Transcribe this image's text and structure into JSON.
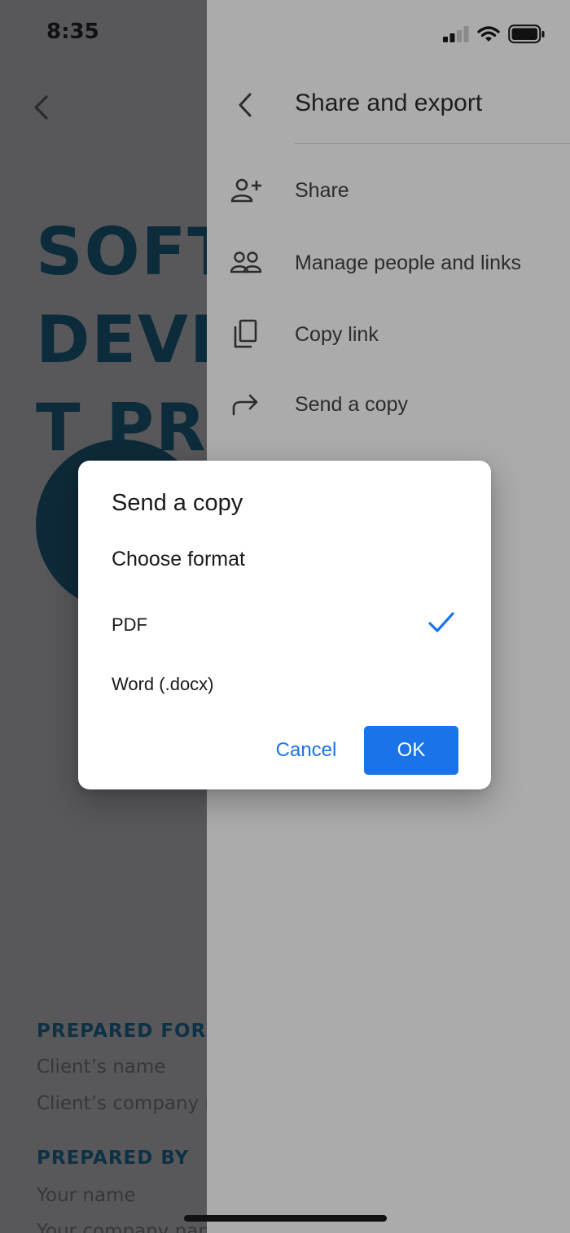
{
  "status_bar": {
    "time": "8:35",
    "icons": [
      "cellular-signal-icon",
      "wifi-icon",
      "battery-icon"
    ]
  },
  "document": {
    "title_lines": [
      "SOFTWARE",
      "DEVELOPMEN",
      "T PROPOSAL"
    ],
    "prepared_for_label": "PREPARED FOR",
    "client_name": "Client’s name",
    "client_company": "Client’s company name",
    "prepared_by_label": "PREPARED BY",
    "your_name": "Your name",
    "your_company": "Your company name",
    "heading_color": "#0c2c3c"
  },
  "share_panel": {
    "title": "Share and export",
    "items": [
      {
        "label": "Share",
        "icon": "add-person-icon"
      },
      {
        "label": "Manage people and links",
        "icon": "people-icon"
      },
      {
        "label": "Copy link",
        "icon": "copy-icon"
      },
      {
        "label": "Send a copy",
        "icon": "forward-arrow-icon"
      }
    ]
  },
  "dialog": {
    "title": "Send a copy",
    "subtitle": "Choose format",
    "options": [
      {
        "label": "PDF",
        "selected": true
      },
      {
        "label": "Word (.docx)",
        "selected": false
      }
    ],
    "cancel_label": "Cancel",
    "ok_label": "OK",
    "accent_color": "#1a73e8"
  }
}
